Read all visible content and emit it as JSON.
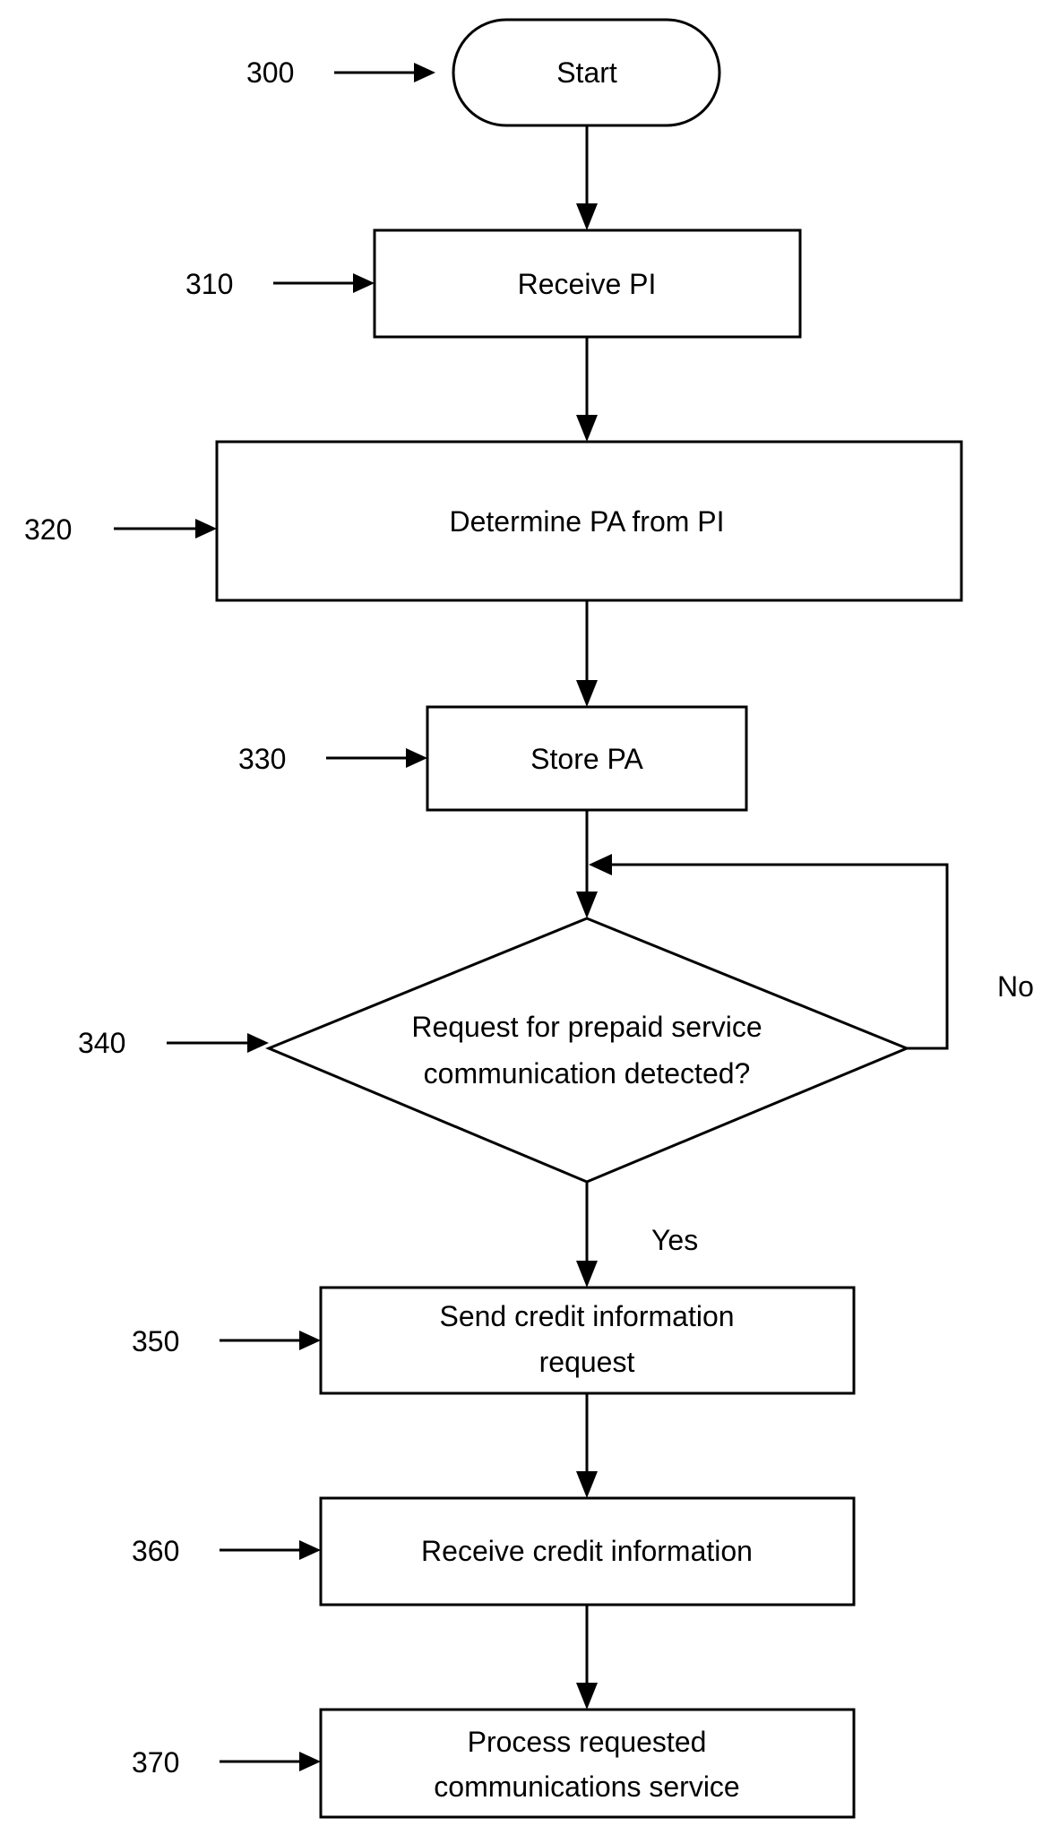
{
  "figure": {
    "type": "flowchart",
    "colors": {
      "stroke": "#000000",
      "background": "#ffffff",
      "text": "#000000"
    }
  },
  "nodes": [
    {
      "id": "300",
      "ref": "300",
      "shape": "terminator",
      "lines": [
        "Start"
      ]
    },
    {
      "id": "310",
      "ref": "310",
      "shape": "process",
      "lines": [
        "Receive PI"
      ]
    },
    {
      "id": "320",
      "ref": "320",
      "shape": "process",
      "lines": [
        "Determine PA from PI"
      ]
    },
    {
      "id": "330",
      "ref": "330",
      "shape": "process",
      "lines": [
        "Store PA"
      ]
    },
    {
      "id": "340",
      "ref": "340",
      "shape": "decision",
      "lines": [
        "Request for prepaid service",
        "communication detected?"
      ]
    },
    {
      "id": "350",
      "ref": "350",
      "shape": "process",
      "lines": [
        "Send credit information",
        "request"
      ]
    },
    {
      "id": "360",
      "ref": "360",
      "shape": "process",
      "lines": [
        "Receive credit information"
      ]
    },
    {
      "id": "370",
      "ref": "370",
      "shape": "process",
      "lines": [
        "Process requested",
        "communications service"
      ]
    }
  ],
  "edges": [
    {
      "from": "300",
      "to": "310",
      "label": ""
    },
    {
      "from": "310",
      "to": "320",
      "label": ""
    },
    {
      "from": "320",
      "to": "330",
      "label": ""
    },
    {
      "from": "330",
      "to": "340",
      "label": ""
    },
    {
      "from": "340",
      "to": "340",
      "label": "No"
    },
    {
      "from": "340",
      "to": "350",
      "label": "Yes"
    },
    {
      "from": "350",
      "to": "360",
      "label": ""
    },
    {
      "from": "360",
      "to": "370",
      "label": ""
    }
  ],
  "branch_labels": {
    "no": "No",
    "yes": "Yes"
  }
}
